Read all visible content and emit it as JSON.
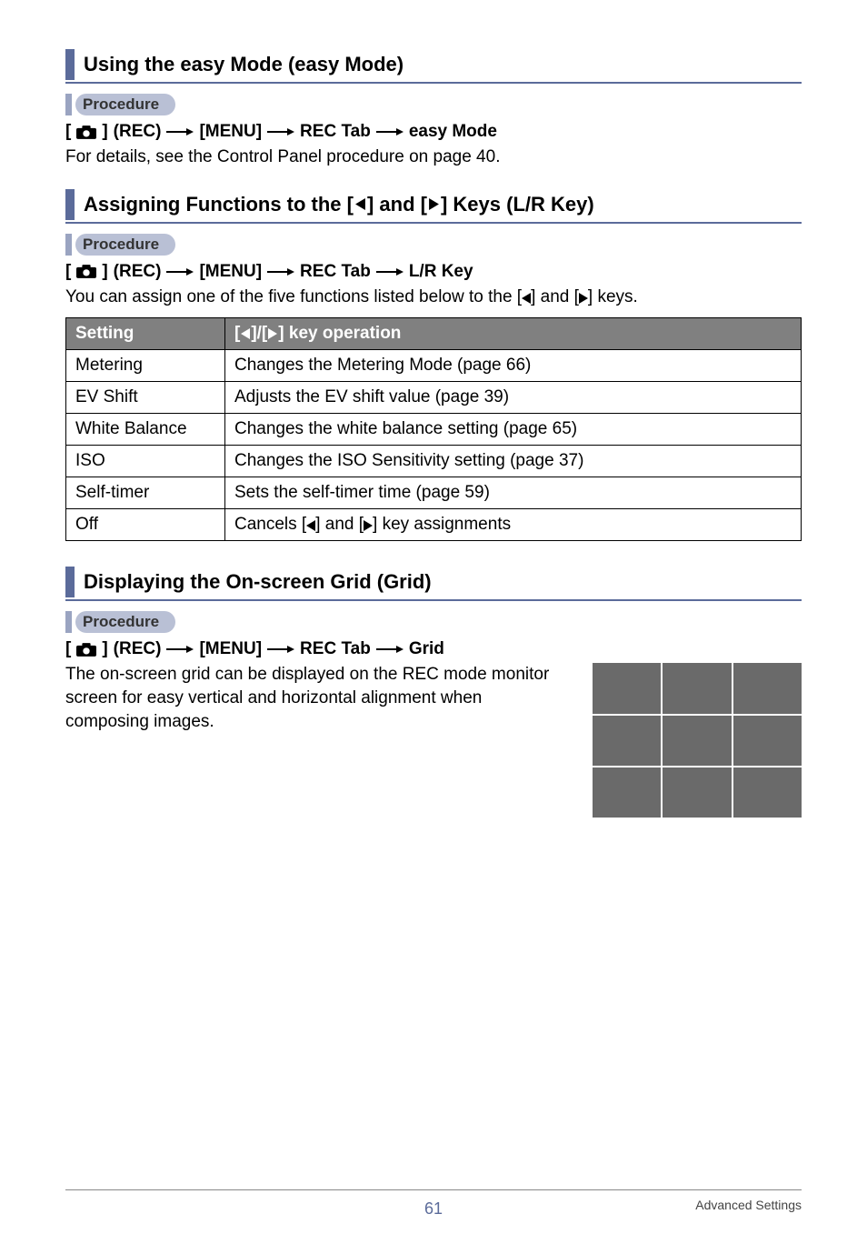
{
  "glyph": {
    "left": "◀",
    "right": "▶"
  },
  "procedure_label": "Procedure",
  "sec1": {
    "title": "Using the easy Mode (easy Mode)",
    "crumb": {
      "p1": "(REC)",
      "p2": "[MENU]",
      "p3": "REC Tab",
      "p4": "easy Mode"
    },
    "body": "For details, see the Control Panel procedure on page 40."
  },
  "sec2": {
    "title_pre": "Assigning Functions to the [",
    "title_mid": "] and [",
    "title_post": "] Keys (L/R Key)",
    "crumb": {
      "p1": "(REC)",
      "p2": "[MENU]",
      "p3": "REC Tab",
      "p4": "L/R Key"
    },
    "body_pre": "You can assign one of the five functions listed below to the [",
    "body_mid": "] and [",
    "body_post": "] keys.",
    "th1": "Setting",
    "th2_pre": "[",
    "th2_sep": "]/[",
    "th2_post": "] key operation",
    "rows": [
      {
        "s": "Metering",
        "d": "Changes the Metering Mode (page 66)"
      },
      {
        "s": "EV Shift",
        "d": "Adjusts the EV shift value (page 39)"
      },
      {
        "s": "White Balance",
        "d": "Changes the white balance setting (page 65)"
      },
      {
        "s": "ISO",
        "d": "Changes the ISO Sensitivity setting (page 37)"
      },
      {
        "s": "Self-timer",
        "d": "Sets the self-timer time (page 59)"
      }
    ],
    "row_off_s": "Off",
    "row_off_pre": "Cancels [",
    "row_off_mid": "] and [",
    "row_off_post": "] key assignments"
  },
  "sec3": {
    "title": "Displaying the On-screen Grid (Grid)",
    "crumb": {
      "p1": "(REC)",
      "p2": "[MENU]",
      "p3": "REC Tab",
      "p4": "Grid"
    },
    "body": "The on-screen grid can be displayed on the REC mode monitor screen for easy vertical and horizontal alignment when composing images."
  },
  "footer": {
    "page": "61",
    "section": "Advanced Settings"
  }
}
